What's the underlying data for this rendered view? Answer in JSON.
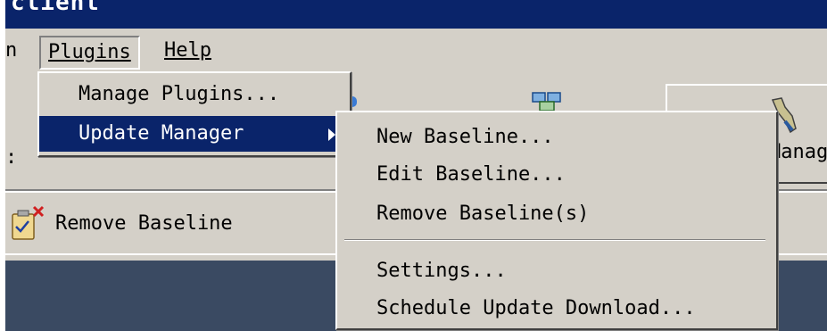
{
  "window": {
    "title_fragment": "client"
  },
  "menubar": {
    "prev_item": "n",
    "plugins": "Plugins",
    "help": "Help"
  },
  "toolbar": {
    "manage_label": "Manag",
    "colon": ":",
    "remove_baseline": "Remove Baseline"
  },
  "plugins_menu": {
    "items": [
      {
        "label": "Manage Plugins..."
      },
      {
        "label": "Update Manager"
      }
    ]
  },
  "update_manager_menu": {
    "items": [
      {
        "label": "New Baseline..."
      },
      {
        "label": "Edit Baseline..."
      },
      {
        "label": "Remove Baseline(s)"
      },
      {
        "label": "Settings..."
      },
      {
        "label": "Schedule Update Download..."
      }
    ]
  },
  "colors": {
    "titlebar": "#0a246a",
    "menu_highlight": "#0a246a",
    "face": "#d4d0c8",
    "bottom_pane": "#3a4a62"
  }
}
